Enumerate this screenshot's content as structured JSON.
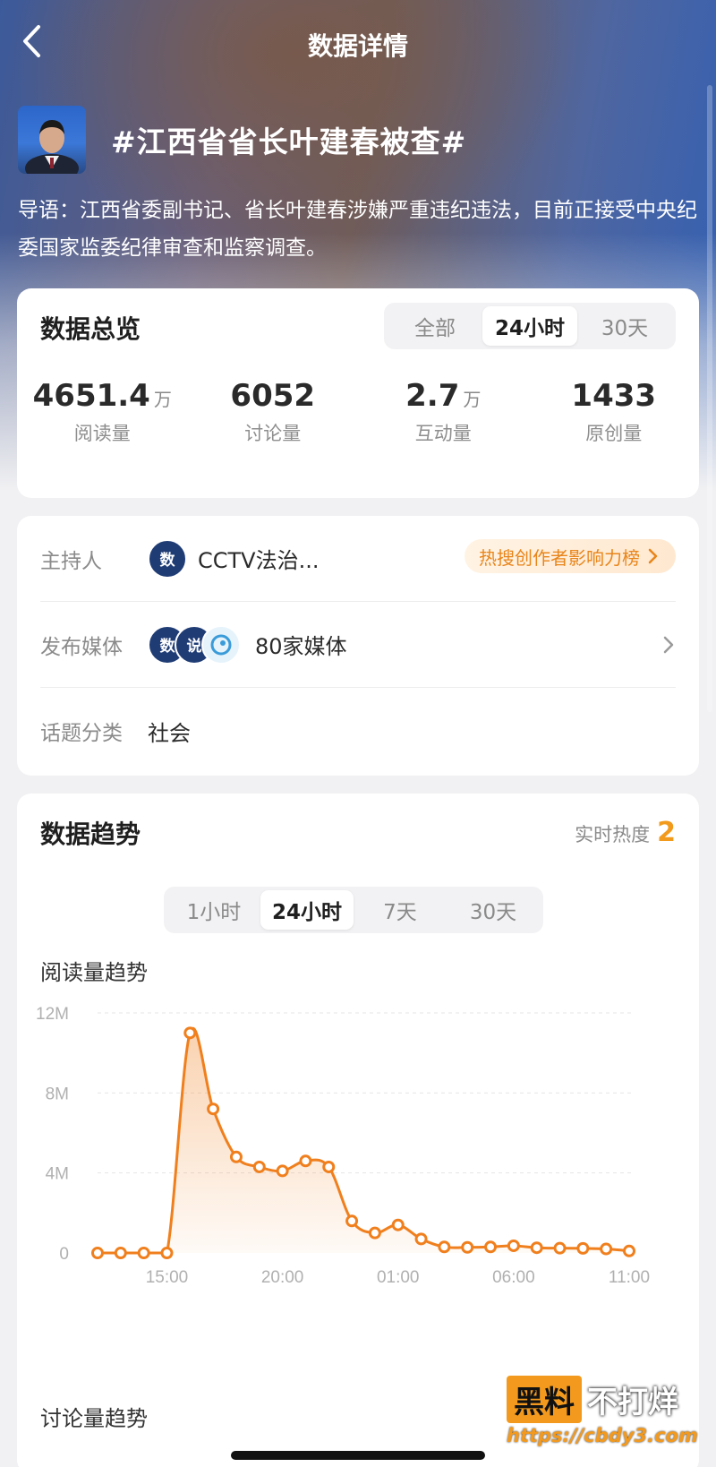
{
  "nav": {
    "title": "数据详情"
  },
  "topic": {
    "title": "#江西省省长叶建春被查#",
    "intro": "导语：江西省委副书记、省长叶建春涉嫌严重违纪违法，目前正接受中央纪委国家监委纪律审查和监察调查。"
  },
  "overview": {
    "title": "数据总览",
    "tabs": [
      "全部",
      "24小时",
      "30天"
    ],
    "active_tab": "24小时",
    "stats": [
      {
        "value": "4651.4",
        "unit": "万",
        "label": "阅读量"
      },
      {
        "value": "6052",
        "unit": "",
        "label": "讨论量"
      },
      {
        "value": "2.7",
        "unit": "万",
        "label": "互动量"
      },
      {
        "value": "1433",
        "unit": "",
        "label": "原创量"
      }
    ]
  },
  "info": {
    "host_label": "主持人",
    "host_name": "CCTV法治...",
    "host_badge": "热搜创作者影响力榜",
    "media_label": "发布媒体",
    "media_value": "80家媒体",
    "category_label": "话题分类",
    "category_value": "社会"
  },
  "trend": {
    "title": "数据趋势",
    "heat_label": "实时热度",
    "heat_value": "2",
    "tabs": [
      "1小时",
      "24小时",
      "7天",
      "30天"
    ],
    "active_tab": "24小时",
    "read_title": "阅读量趋势",
    "discuss_title": "讨论量趋势"
  },
  "chart_data": {
    "type": "area",
    "title": "阅读量趋势",
    "x_tick_labels": [
      "15:00",
      "20:00",
      "01:00",
      "06:00",
      "11:00"
    ],
    "y_tick_labels": [
      "0",
      "4M",
      "8M",
      "12M"
    ],
    "ylim": [
      0,
      12000000
    ],
    "grid": true,
    "series": [
      {
        "values": [
          0,
          0,
          0,
          0,
          11000000,
          7200000,
          4800000,
          4300000,
          4100000,
          4600000,
          4300000,
          1600000,
          1000000,
          1400000,
          700000,
          300000,
          280000,
          300000,
          360000,
          260000,
          240000,
          230000,
          200000,
          100000
        ]
      }
    ],
    "color": "#f07f1d"
  },
  "watermark": {
    "brand_box": "黑料",
    "brand_text": "不打烊",
    "url": "https://cbdy3.com"
  }
}
